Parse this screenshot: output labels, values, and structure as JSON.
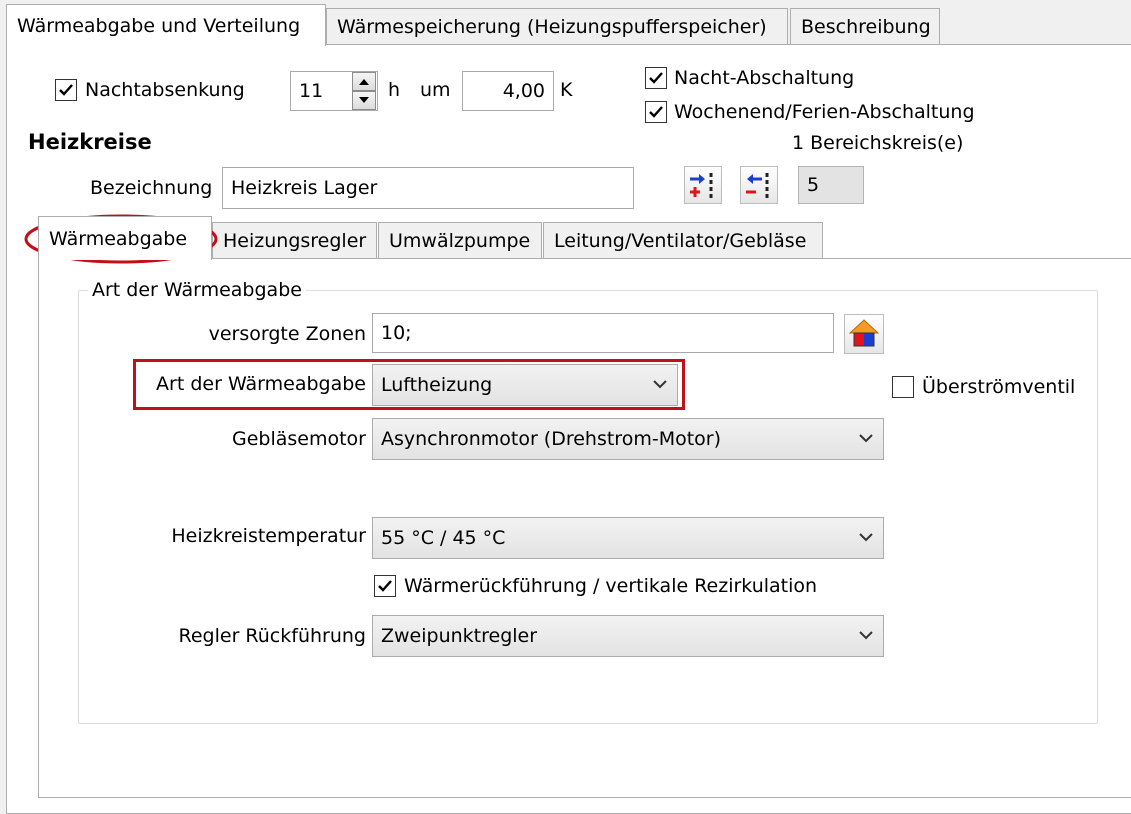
{
  "top_tabs": [
    "Wärmeabgabe und Verteilung",
    "Wärmespeicherung (Heizungspufferspeicher)",
    "Beschreibung"
  ],
  "night": {
    "checkbox_label": "Nachtabsenkung",
    "checked": true,
    "hours": "11",
    "hours_unit": "h",
    "um_label": "um",
    "kelvin": "4,00",
    "kelvin_unit": "K"
  },
  "shutdown": [
    {
      "label": "Nacht-Abschaltung",
      "checked": true
    },
    {
      "label": "Wochenend/Ferien-Abschaltung",
      "checked": true
    }
  ],
  "heizkreise": {
    "title": "Heizkreise",
    "count_label": "1 Bereichskreis(e)",
    "bezeichnung_label": "Bezeichnung",
    "bezeichnung_value": "Heizkreis Lager",
    "number": "5"
  },
  "inner_tabs": [
    "Wärmeabgabe",
    "Heizungsregler",
    "Umwälzpumpe",
    "Leitung/Ventilator/Gebläse"
  ],
  "group": {
    "legend": "Art der Wärmeabgabe",
    "zonen_label": "versorgte Zonen",
    "zonen_value": "10;",
    "art_label": "Art der Wärmeabgabe",
    "art_value": "Luftheizung",
    "ueberstroem_label": "Überströmventil",
    "ueberstroem_checked": false,
    "geblaese_label": "Gebläsemotor",
    "geblaese_value": "Asynchronmotor (Drehstrom-Motor)",
    "temp_label": "Heizkreistemperatur",
    "temp_value": "55 °C / 45 °C",
    "rueck_label": "Wärmerückführung / vertikale Rezirkulation",
    "rueck_checked": true,
    "regler_label": "Regler Rückführung",
    "regler_value": "Zweipunktregler"
  },
  "colors": {
    "highlight_red": "#c0101a",
    "icon_blue": "#1a3fd0",
    "icon_red": "#e0141e"
  }
}
